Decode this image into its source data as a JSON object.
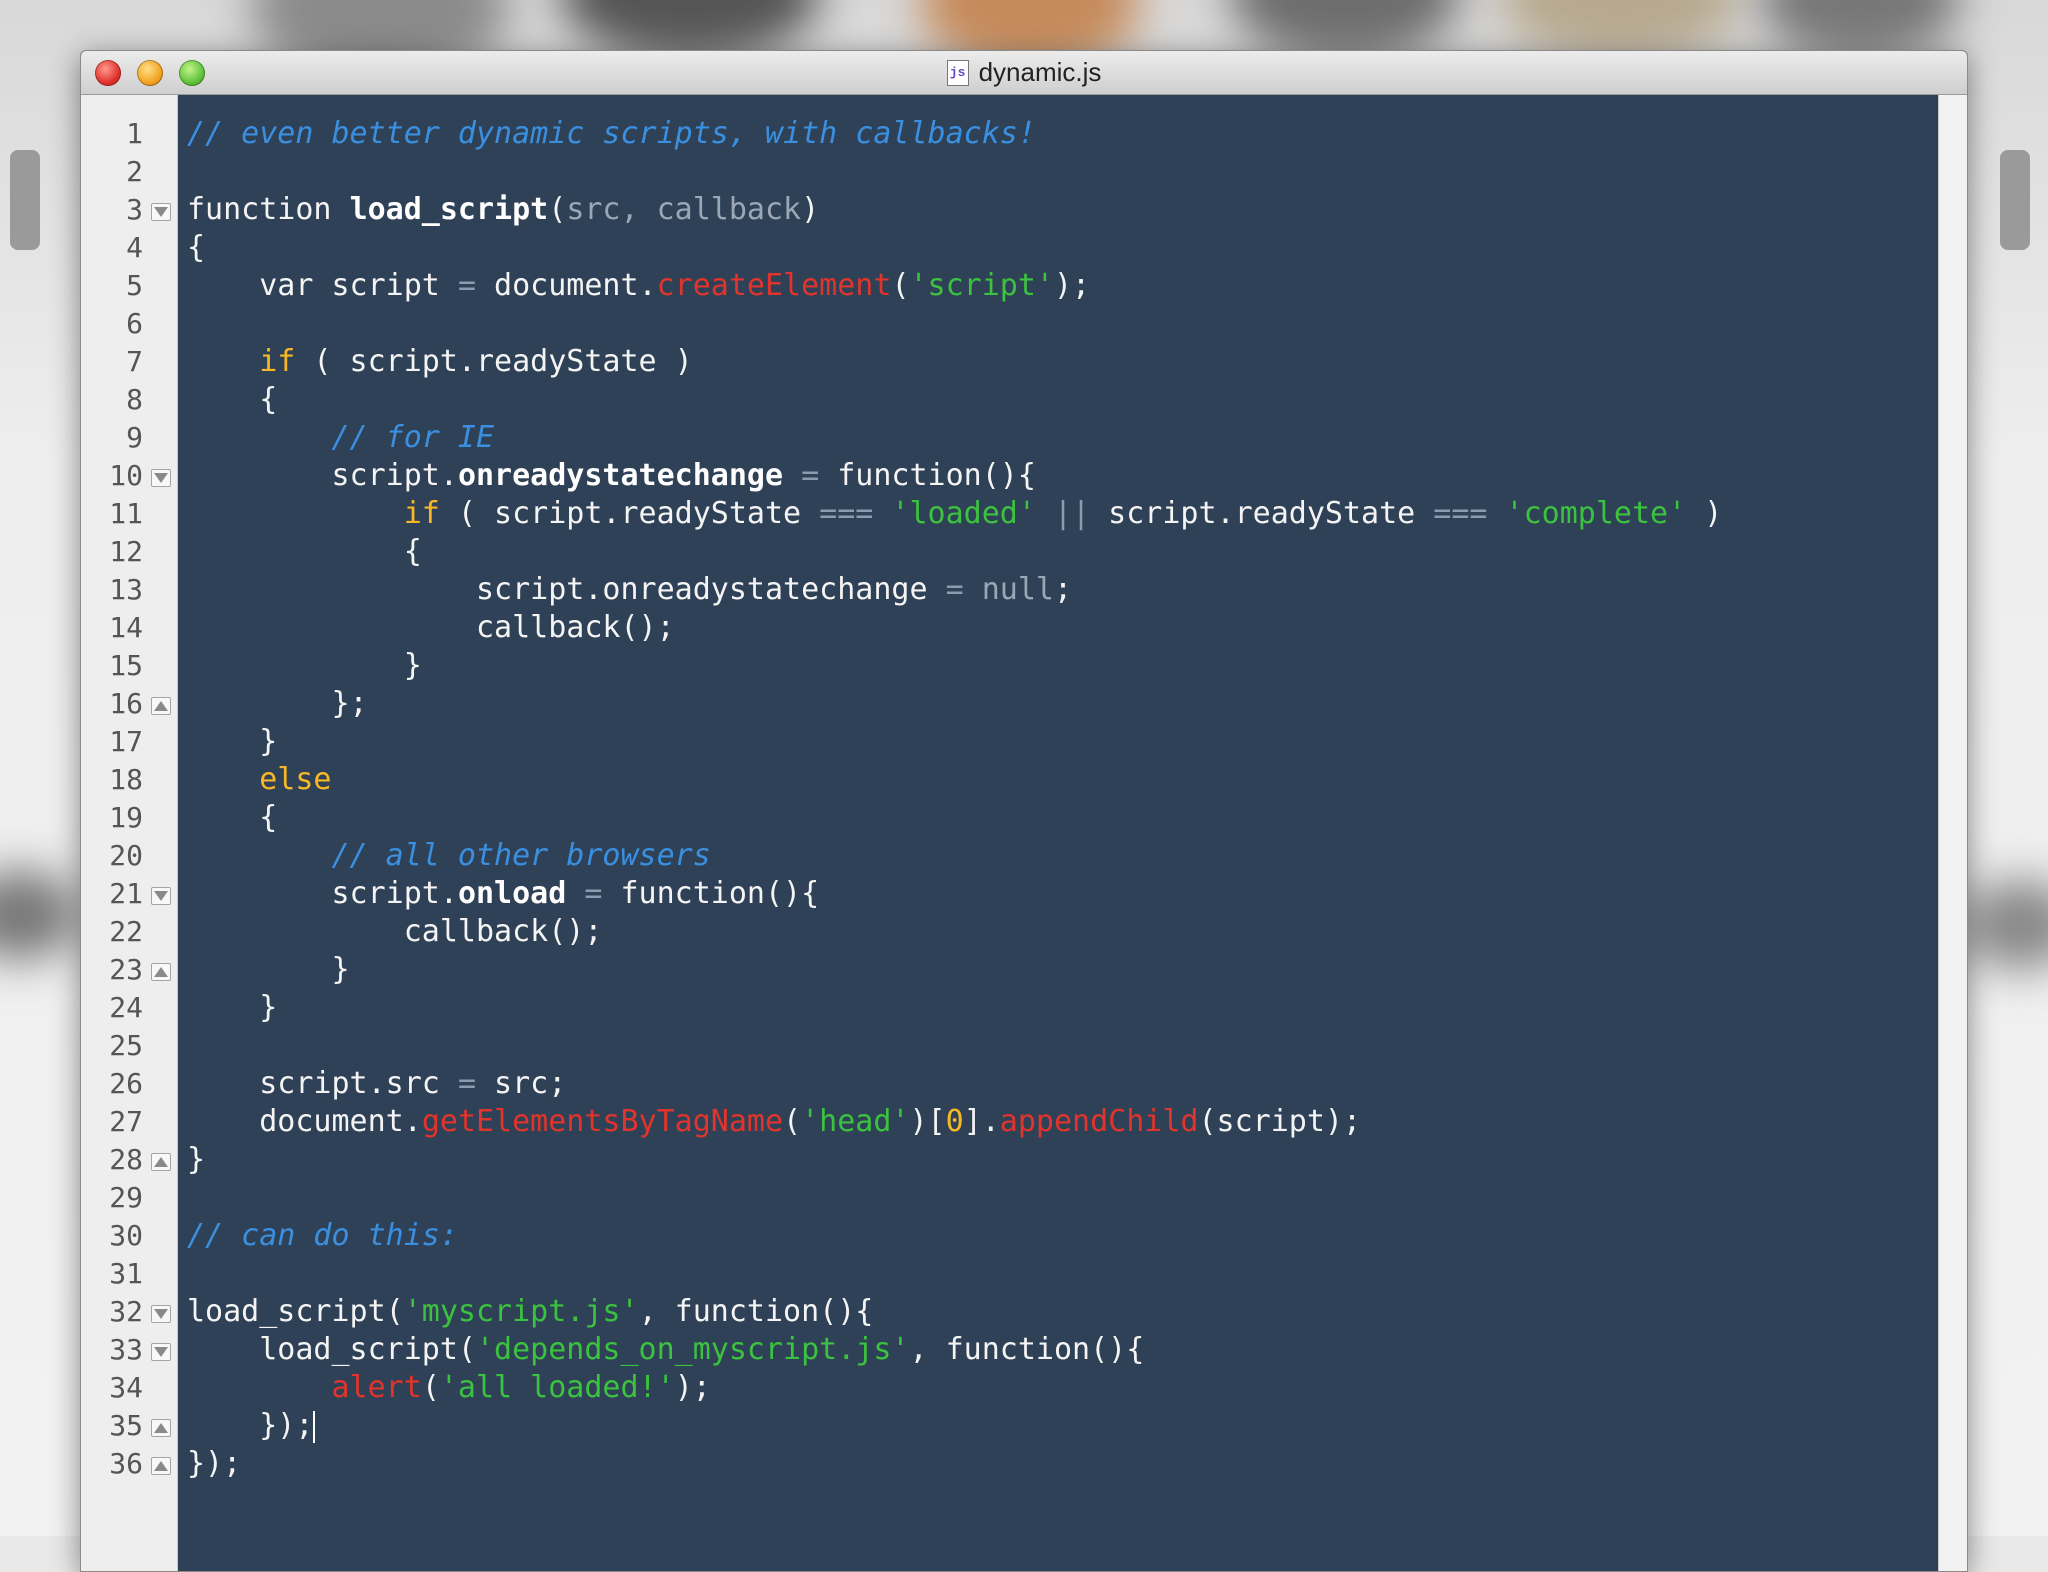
{
  "window": {
    "title": "dynamic.js",
    "file_icon_label": "js",
    "buttons": [
      "close",
      "minimize",
      "zoom"
    ]
  },
  "editor": {
    "theme": "dark",
    "language": "javascript",
    "colors": {
      "background": "#2f4156",
      "comment": "#3b8fe0",
      "keyword": "#f7b726",
      "string": "#3bc23f",
      "builtin": "#e0342c"
    },
    "lines": [
      {
        "n": "1",
        "fold": "",
        "tokens": [
          {
            "t": "// even better dynamic scripts, with callbacks!",
            "c": "cm"
          }
        ]
      },
      {
        "n": "2",
        "fold": "",
        "tokens": []
      },
      {
        "n": "3",
        "fold": "open",
        "tokens": [
          {
            "t": "function ",
            "c": ""
          },
          {
            "t": "load_script",
            "c": "fn"
          },
          {
            "t": "(",
            "c": ""
          },
          {
            "t": "src, callback",
            "c": "prm"
          },
          {
            "t": ")",
            "c": ""
          }
        ]
      },
      {
        "n": "4",
        "fold": "",
        "tokens": [
          {
            "t": "{",
            "c": ""
          }
        ]
      },
      {
        "n": "5",
        "fold": "",
        "tokens": [
          {
            "t": "    var script ",
            "c": ""
          },
          {
            "t": "=",
            "c": "op"
          },
          {
            "t": " document.",
            "c": ""
          },
          {
            "t": "createElement",
            "c": "mth"
          },
          {
            "t": "(",
            "c": ""
          },
          {
            "t": "'script'",
            "c": "str"
          },
          {
            "t": ");",
            "c": ""
          }
        ]
      },
      {
        "n": "6",
        "fold": "",
        "tokens": []
      },
      {
        "n": "7",
        "fold": "",
        "tokens": [
          {
            "t": "    ",
            "c": ""
          },
          {
            "t": "if",
            "c": "kw"
          },
          {
            "t": " ( script.readyState )",
            "c": ""
          }
        ]
      },
      {
        "n": "8",
        "fold": "",
        "tokens": [
          {
            "t": "    {",
            "c": ""
          }
        ]
      },
      {
        "n": "9",
        "fold": "",
        "tokens": [
          {
            "t": "        ",
            "c": ""
          },
          {
            "t": "// for IE",
            "c": "cm"
          }
        ]
      },
      {
        "n": "10",
        "fold": "open",
        "tokens": [
          {
            "t": "        script.",
            "c": ""
          },
          {
            "t": "onreadystatechange",
            "c": "fn"
          },
          {
            "t": " ",
            "c": ""
          },
          {
            "t": "=",
            "c": "op"
          },
          {
            "t": " function(){",
            "c": ""
          }
        ]
      },
      {
        "n": "11",
        "fold": "",
        "tokens": [
          {
            "t": "            ",
            "c": ""
          },
          {
            "t": "if",
            "c": "kw"
          },
          {
            "t": " ( script.readyState ",
            "c": ""
          },
          {
            "t": "===",
            "c": "op"
          },
          {
            "t": " ",
            "c": ""
          },
          {
            "t": "'loaded'",
            "c": "str"
          },
          {
            "t": " ",
            "c": ""
          },
          {
            "t": "||",
            "c": "op"
          },
          {
            "t": " script.readyState ",
            "c": ""
          },
          {
            "t": "===",
            "c": "op"
          },
          {
            "t": " ",
            "c": ""
          },
          {
            "t": "'complete'",
            "c": "str"
          },
          {
            "t": " )",
            "c": ""
          }
        ]
      },
      {
        "n": "12",
        "fold": "",
        "tokens": [
          {
            "t": "            {",
            "c": ""
          }
        ]
      },
      {
        "n": "13",
        "fold": "",
        "tokens": [
          {
            "t": "                script.onreadystatechange ",
            "c": ""
          },
          {
            "t": "=",
            "c": "op"
          },
          {
            "t": " ",
            "c": ""
          },
          {
            "t": "null",
            "c": "prm"
          },
          {
            "t": ";",
            "c": ""
          }
        ]
      },
      {
        "n": "14",
        "fold": "",
        "tokens": [
          {
            "t": "                callback();",
            "c": ""
          }
        ]
      },
      {
        "n": "15",
        "fold": "",
        "tokens": [
          {
            "t": "            }",
            "c": ""
          }
        ]
      },
      {
        "n": "16",
        "fold": "close",
        "tokens": [
          {
            "t": "        };",
            "c": ""
          }
        ]
      },
      {
        "n": "17",
        "fold": "",
        "tokens": [
          {
            "t": "    }",
            "c": ""
          }
        ]
      },
      {
        "n": "18",
        "fold": "",
        "tokens": [
          {
            "t": "    ",
            "c": ""
          },
          {
            "t": "else",
            "c": "kw"
          }
        ]
      },
      {
        "n": "19",
        "fold": "",
        "tokens": [
          {
            "t": "    {",
            "c": ""
          }
        ]
      },
      {
        "n": "20",
        "fold": "",
        "tokens": [
          {
            "t": "        ",
            "c": ""
          },
          {
            "t": "// all other browsers",
            "c": "cm"
          }
        ]
      },
      {
        "n": "21",
        "fold": "open",
        "tokens": [
          {
            "t": "        script.",
            "c": ""
          },
          {
            "t": "onload",
            "c": "fn"
          },
          {
            "t": " ",
            "c": ""
          },
          {
            "t": "=",
            "c": "op"
          },
          {
            "t": " function(){",
            "c": ""
          }
        ]
      },
      {
        "n": "22",
        "fold": "",
        "tokens": [
          {
            "t": "            callback();",
            "c": ""
          }
        ]
      },
      {
        "n": "23",
        "fold": "close",
        "tokens": [
          {
            "t": "        }",
            "c": ""
          }
        ]
      },
      {
        "n": "24",
        "fold": "",
        "tokens": [
          {
            "t": "    }",
            "c": ""
          }
        ]
      },
      {
        "n": "25",
        "fold": "",
        "tokens": []
      },
      {
        "n": "26",
        "fold": "",
        "tokens": [
          {
            "t": "    script.src ",
            "c": ""
          },
          {
            "t": "=",
            "c": "op"
          },
          {
            "t": " src;",
            "c": ""
          }
        ]
      },
      {
        "n": "27",
        "fold": "",
        "tokens": [
          {
            "t": "    document.",
            "c": ""
          },
          {
            "t": "getElementsByTagName",
            "c": "mth"
          },
          {
            "t": "(",
            "c": ""
          },
          {
            "t": "'head'",
            "c": "str"
          },
          {
            "t": ")[",
            "c": ""
          },
          {
            "t": "0",
            "c": "num"
          },
          {
            "t": "].",
            "c": ""
          },
          {
            "t": "appendChild",
            "c": "mth"
          },
          {
            "t": "(script);",
            "c": ""
          }
        ]
      },
      {
        "n": "28",
        "fold": "close",
        "tokens": [
          {
            "t": "}",
            "c": ""
          }
        ]
      },
      {
        "n": "29",
        "fold": "",
        "tokens": []
      },
      {
        "n": "30",
        "fold": "",
        "tokens": [
          {
            "t": "// can do this:",
            "c": "cm"
          }
        ]
      },
      {
        "n": "31",
        "fold": "",
        "tokens": []
      },
      {
        "n": "32",
        "fold": "open",
        "tokens": [
          {
            "t": "load_script(",
            "c": ""
          },
          {
            "t": "'myscript.js'",
            "c": "str"
          },
          {
            "t": ", function(){",
            "c": ""
          }
        ]
      },
      {
        "n": "33",
        "fold": "open",
        "tokens": [
          {
            "t": "    load_script(",
            "c": ""
          },
          {
            "t": "'depends_on_myscript.js'",
            "c": "str"
          },
          {
            "t": ", function(){",
            "c": ""
          }
        ]
      },
      {
        "n": "34",
        "fold": "",
        "tokens": [
          {
            "t": "        ",
            "c": ""
          },
          {
            "t": "alert",
            "c": "mth"
          },
          {
            "t": "(",
            "c": ""
          },
          {
            "t": "'all loaded!'",
            "c": "str"
          },
          {
            "t": ");",
            "c": ""
          }
        ]
      },
      {
        "n": "35",
        "fold": "close",
        "tokens": [
          {
            "t": "    });",
            "c": ""
          },
          {
            "t": "",
            "c": "caret"
          }
        ]
      },
      {
        "n": "36",
        "fold": "close",
        "tokens": [
          {
            "t": "});",
            "c": ""
          }
        ]
      }
    ]
  }
}
